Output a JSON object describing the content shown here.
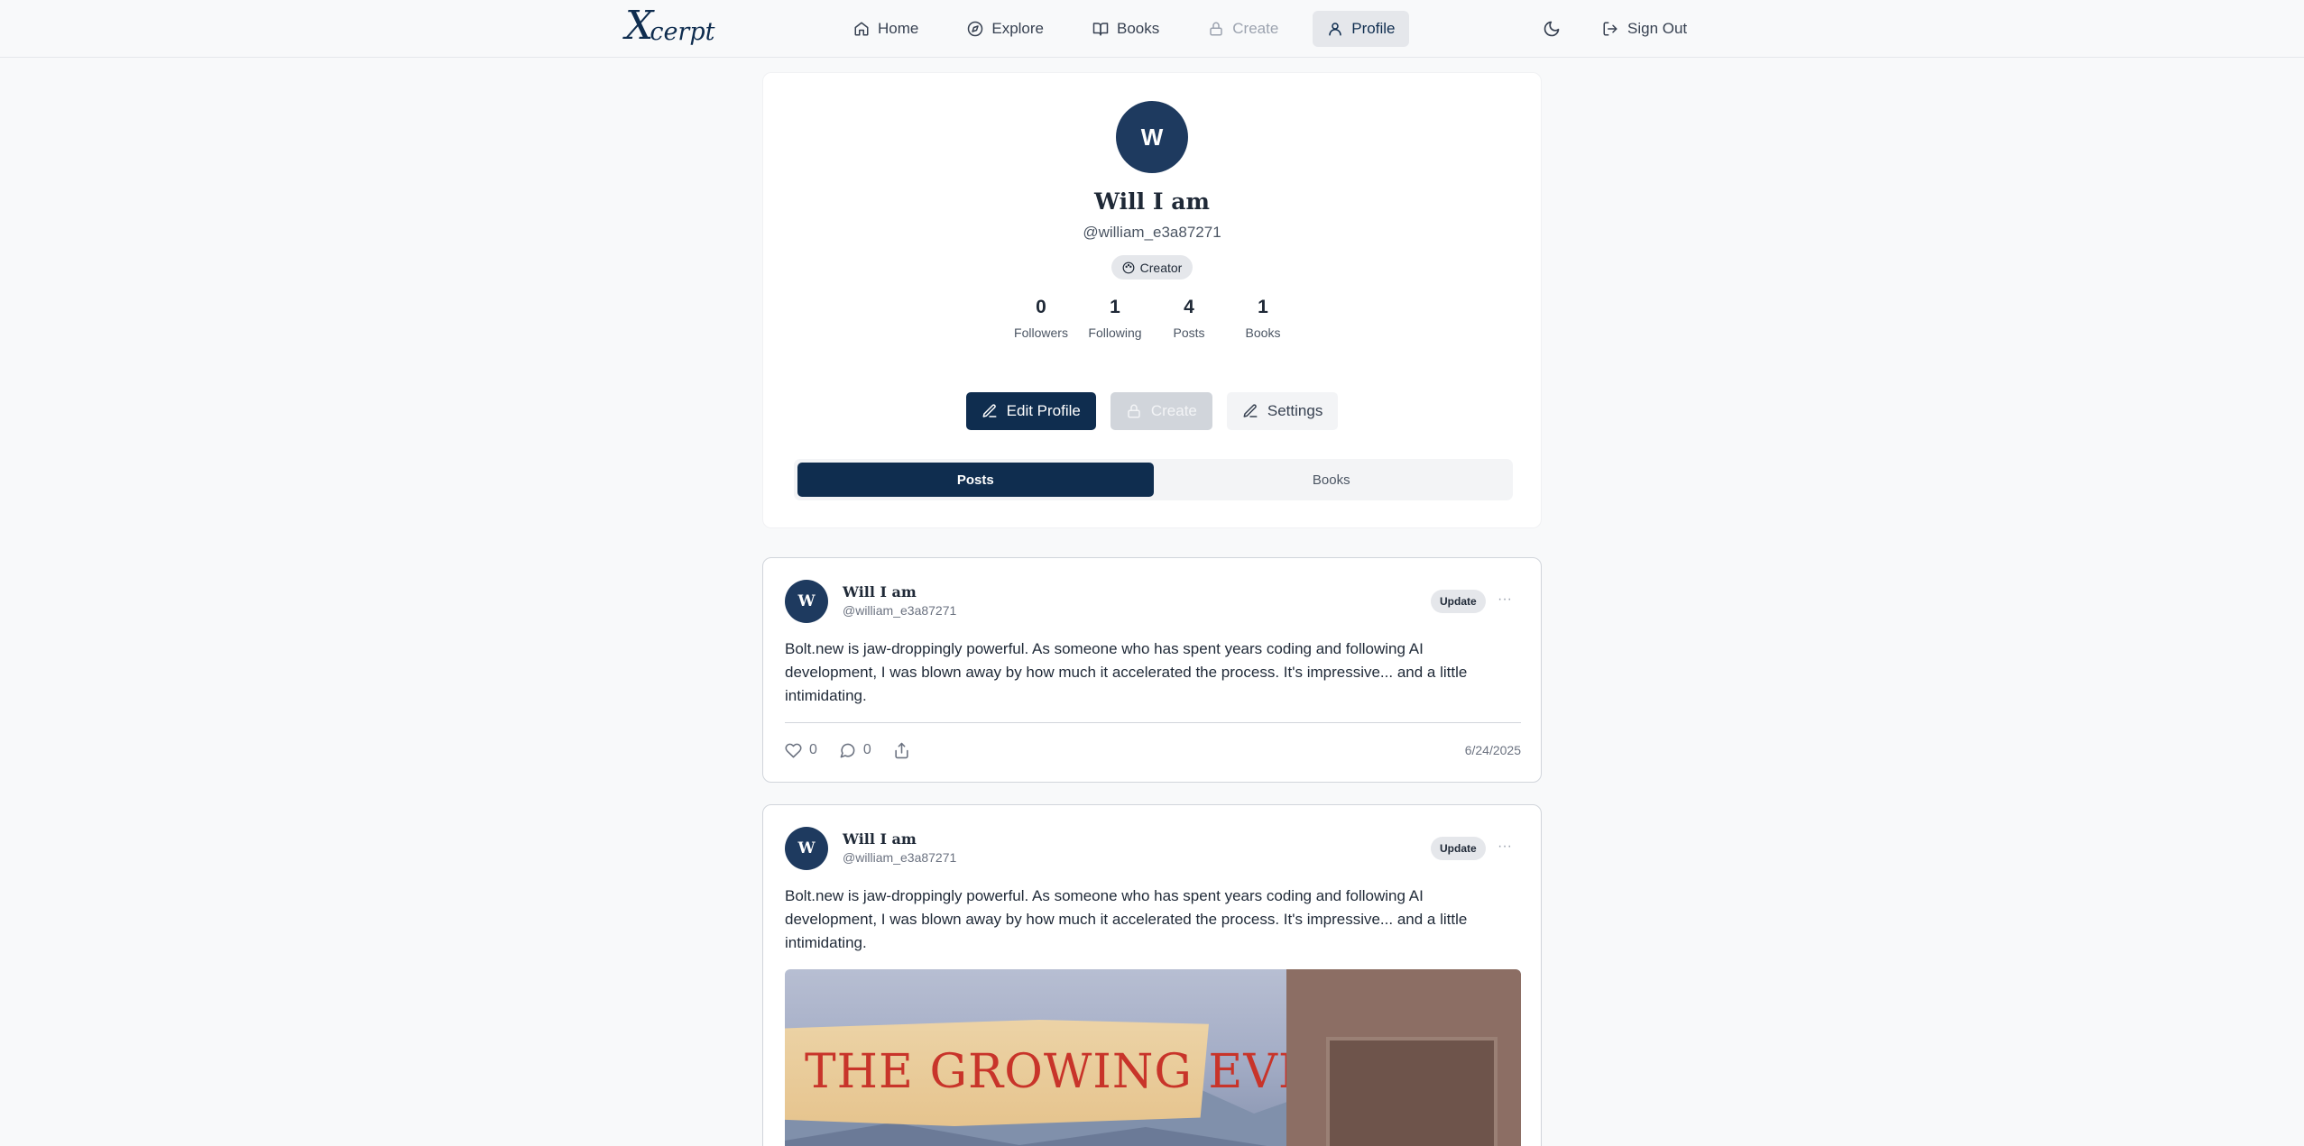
{
  "nav": {
    "logo_text": "cerpt",
    "logo_letter": "X",
    "links": [
      {
        "label": "Home",
        "icon": "home-icon"
      },
      {
        "label": "Explore",
        "icon": "compass-icon"
      },
      {
        "label": "Books",
        "icon": "book-open-icon"
      },
      {
        "label": "Create",
        "icon": "lock-icon"
      },
      {
        "label": "Profile",
        "icon": "user-icon"
      }
    ],
    "sign_out": "Sign Out"
  },
  "profile": {
    "avatar_initial": "W",
    "name": "Will I am",
    "handle": "@william_e3a87271",
    "badge": "Creator",
    "stats": [
      {
        "value": "0",
        "label": "Followers"
      },
      {
        "value": "1",
        "label": "Following"
      },
      {
        "value": "4",
        "label": "Posts"
      },
      {
        "value": "1",
        "label": "Books"
      }
    ],
    "actions": {
      "edit": "Edit Profile",
      "create": "Create",
      "settings": "Settings"
    },
    "tabs": [
      "Posts",
      "Books"
    ]
  },
  "posts": [
    {
      "avatar_initial": "W",
      "author": "Will I am",
      "handle": "@william_e3a87271",
      "badge": "Update",
      "more": "···",
      "text": "Bolt.new is jaw-droppingly powerful. As someone who has spent years coding and following AI development, I was blown away by how much it accelerated the process. It's impressive... and a little intimidating.",
      "likes": "0",
      "comments": "0",
      "date": "6/24/2025"
    },
    {
      "avatar_initial": "W",
      "author": "Will I am",
      "handle": "@william_e3a87271",
      "badge": "Update",
      "more": "···",
      "text": "Bolt.new is jaw-droppingly powerful. As someone who has spent years coding and following AI development, I was blown away by how much it accelerated the process. It's impressive... and a little intimidating.",
      "image_title": "THE GROWING EVIL"
    }
  ],
  "colors": {
    "brand": "#0f2d4f",
    "avatar": "#1e3a5f",
    "background": "#f8f9fa"
  }
}
